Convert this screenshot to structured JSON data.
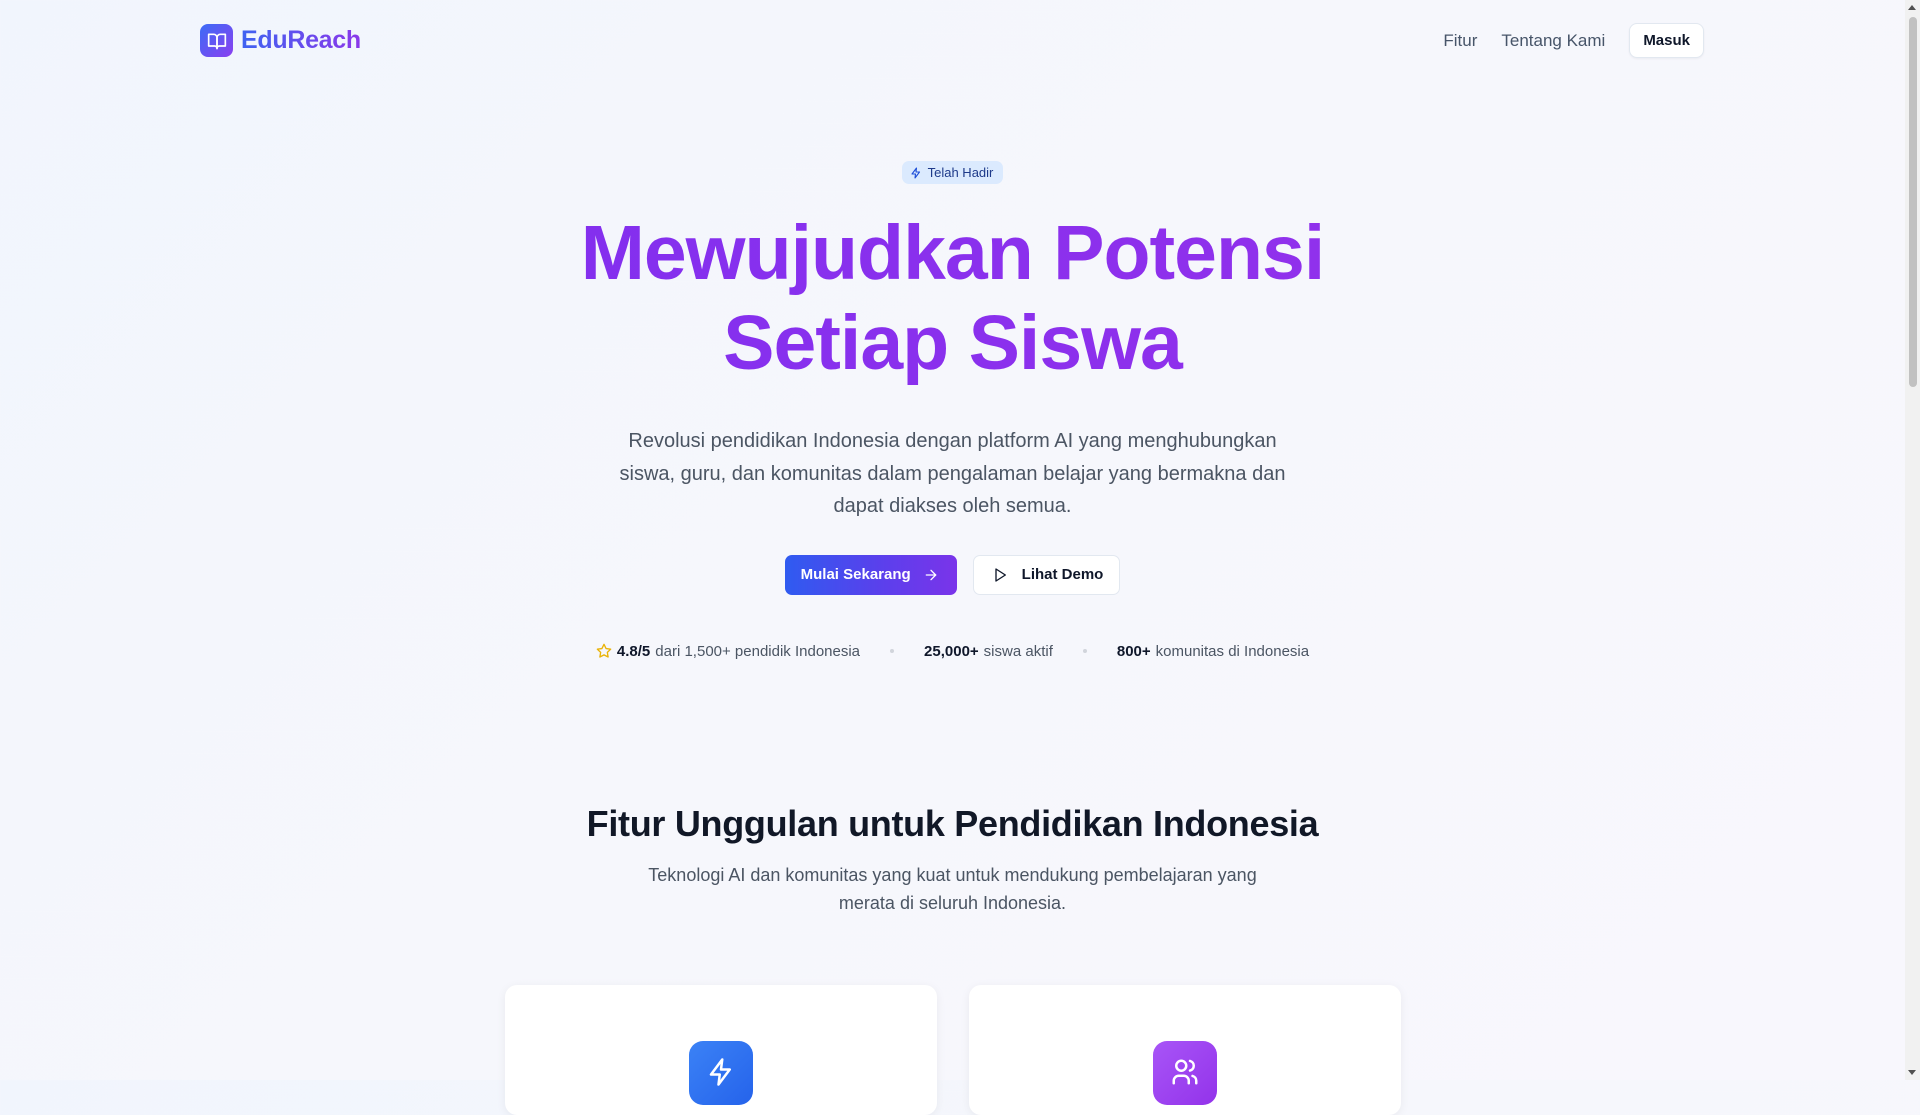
{
  "header": {
    "brand": "EduReach",
    "nav": [
      {
        "label": "Fitur"
      },
      {
        "label": "Tentang Kami"
      }
    ],
    "login_label": "Masuk"
  },
  "hero": {
    "badge": "Telah Hadir",
    "title_line1": "Mewujudkan Potensi",
    "title_line2": "Setiap Siswa",
    "subtitle": "Revolusi pendidikan Indonesia dengan platform AI yang menghubungkan siswa, guru, dan komunitas dalam pengalaman belajar yang bermakna dan dapat diakses oleh semua.",
    "primary_cta": "Mulai Sekarang",
    "secondary_cta": "Lihat Demo",
    "stats": [
      {
        "value": "4.8/5",
        "text": "dari 1,500+ pendidik Indonesia"
      },
      {
        "value": "25,000+",
        "text": "siswa aktif"
      },
      {
        "value": "800+",
        "text": "komunitas di Indonesia"
      }
    ]
  },
  "features": {
    "title": "Fitur Unggulan untuk Pendidikan Indonesia",
    "subtitle": "Teknologi AI dan komunitas yang kuat untuk mendukung pembelajaran yang merata di seluruh Indonesia.",
    "cards": [
      {
        "icon": "lightning-icon"
      },
      {
        "icon": "users-icon"
      }
    ]
  },
  "colors": {
    "brand_blue": "#3e62f1",
    "brand_purple": "#8b38ea",
    "star": "#eab308"
  }
}
